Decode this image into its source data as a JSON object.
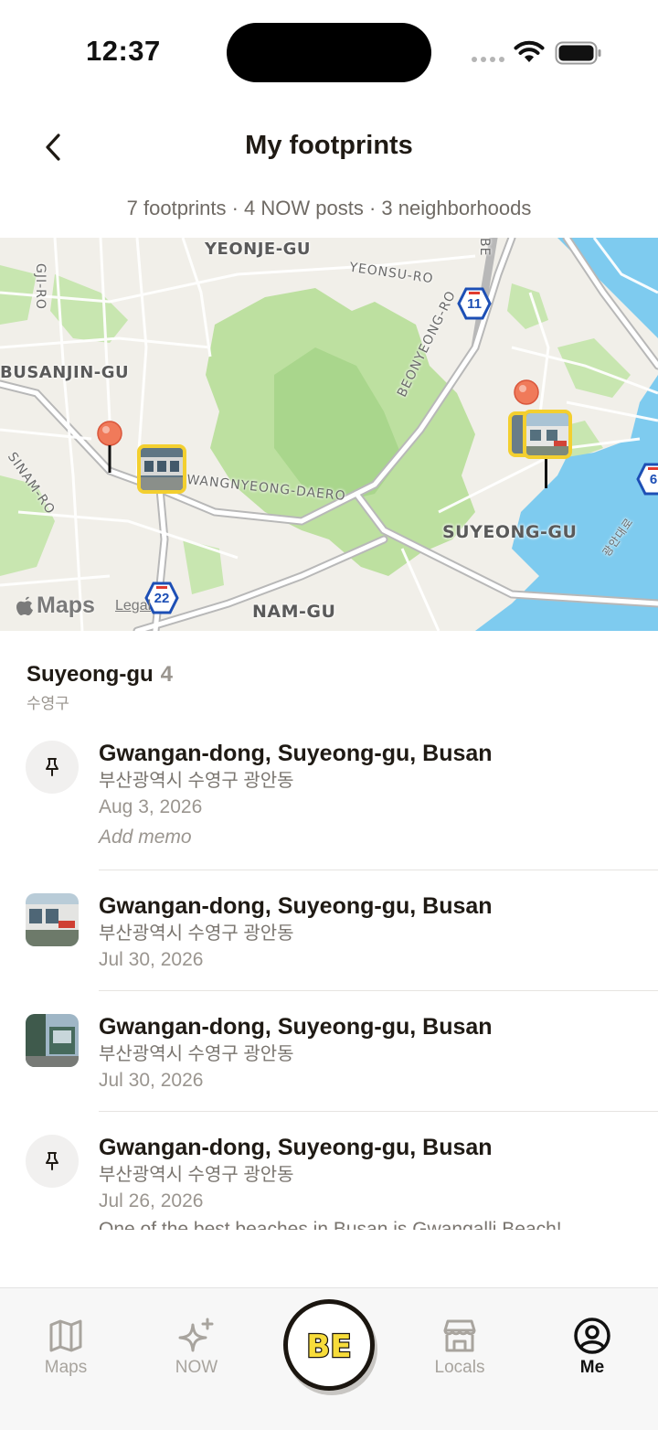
{
  "status_bar": {
    "time": "12:37"
  },
  "header": {
    "title": "My footprints",
    "summary": "7 footprints · 4 NOW posts · 3 neighborhoods"
  },
  "map": {
    "districts": [
      "YEONJE-GU",
      "BUSANJIN-GU",
      "SUYEONG-GU",
      "NAM-GU"
    ],
    "roads": [
      "GJI-RO",
      "YEONSU-RO",
      "BEONYEONG-RO",
      "SINAM-RO",
      "WANGNYEONG-DAERO",
      "광안대로",
      "BE"
    ],
    "route_shields": [
      "11",
      "22",
      "6"
    ],
    "attribution": "Maps",
    "legal": "Legal",
    "colors": {
      "park": "#bde0a0",
      "water": "#7ecbef",
      "land": "#f1efe9",
      "pin": "#f07a5a",
      "photo_border": "#f3cf2f"
    }
  },
  "section": {
    "title": "Suyeong-gu",
    "count": "4",
    "subtitle": "수영구"
  },
  "items": [
    {
      "title": "Gwangan-dong, Suyeong-gu, Busan",
      "subtitle": "부산광역시 수영구 광안동",
      "date": "Aug 3, 2026",
      "memo": "Add memo",
      "thumb": "pin-icon"
    },
    {
      "title": "Gwangan-dong, Suyeong-gu, Busan",
      "subtitle": "부산광역시 수영구 광안동",
      "date": "Jul 30, 2026",
      "thumb": "photo"
    },
    {
      "title": "Gwangan-dong, Suyeong-gu, Busan",
      "subtitle": "부산광역시 수영구 광안동",
      "date": "Jul 30, 2026",
      "thumb": "photo"
    },
    {
      "title": "Gwangan-dong, Suyeong-gu, Busan",
      "subtitle": "부산광역시 수영구 광안동",
      "date": "Jul 26, 2026",
      "note": "One of the best beaches in Busan is Gwangalli Beach!",
      "thumb": "pin-icon"
    }
  ],
  "bottom_nav": {
    "maps": "Maps",
    "now": "NOW",
    "be": "BE",
    "locals": "Locals",
    "me": "Me",
    "active": "Me",
    "brand_yellow": "#f7dc3a"
  }
}
